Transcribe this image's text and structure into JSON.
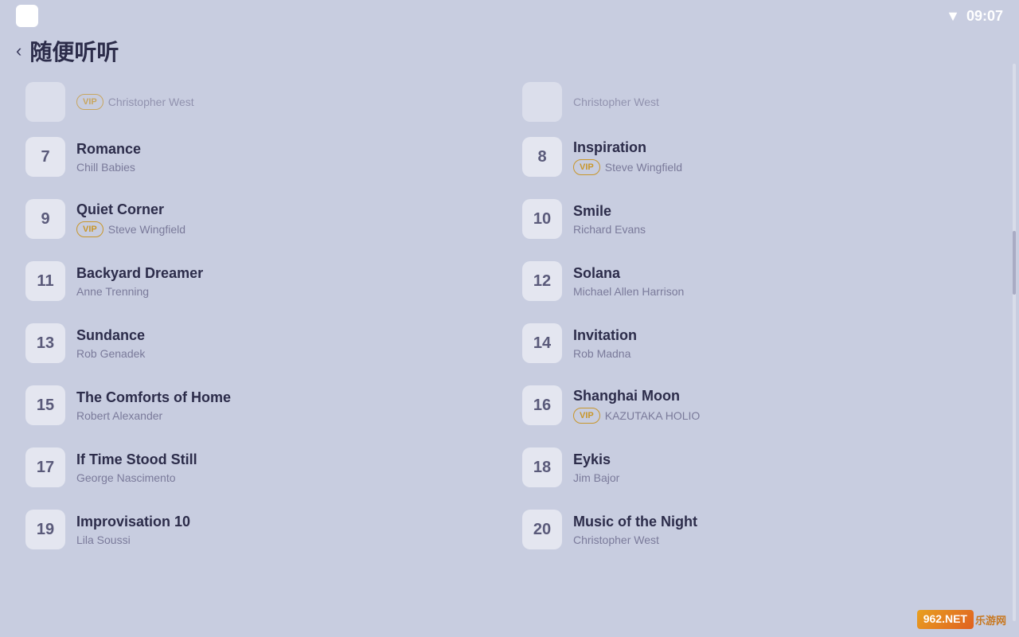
{
  "statusBar": {
    "time": "09:07",
    "wifiIcon": "▼"
  },
  "header": {
    "backLabel": "‹",
    "title": "随便听听"
  },
  "partialTopItems": [
    {
      "id": "partial-left",
      "number": "",
      "hasVip": true,
      "artist": "Christopher West"
    },
    {
      "id": "partial-right",
      "number": "",
      "hasVip": false,
      "artist": "Christopher West"
    }
  ],
  "tracks": [
    {
      "id": 7,
      "number": "7",
      "title": "Romance",
      "artist": "Chill Babies",
      "hasVip": false
    },
    {
      "id": 8,
      "number": "8",
      "title": "Inspiration",
      "artist": "Steve Wingfield",
      "hasVip": true
    },
    {
      "id": 9,
      "number": "9",
      "title": "Quiet Corner",
      "artist": "Steve Wingfield",
      "hasVip": true
    },
    {
      "id": 10,
      "number": "10",
      "title": "Smile",
      "artist": "Richard Evans",
      "hasVip": false
    },
    {
      "id": 11,
      "number": "11",
      "title": "Backyard Dreamer",
      "artist": "Anne Trenning",
      "hasVip": false
    },
    {
      "id": 12,
      "number": "12",
      "title": "Solana",
      "artist": "Michael Allen Harrison",
      "hasVip": false
    },
    {
      "id": 13,
      "number": "13",
      "title": "Sundance",
      "artist": "Rob Genadek",
      "hasVip": false
    },
    {
      "id": 14,
      "number": "14",
      "title": "Invitation",
      "artist": "Rob Madna",
      "hasVip": false
    },
    {
      "id": 15,
      "number": "15",
      "title": "The Comforts of Home",
      "artist": "Robert Alexander",
      "hasVip": false
    },
    {
      "id": 16,
      "number": "16",
      "title": "Shanghai Moon",
      "artist": "KAZUTAKA HOLIO",
      "hasVip": true
    },
    {
      "id": 17,
      "number": "17",
      "title": "If Time Stood Still",
      "artist": "George Nascimento",
      "hasVip": false
    },
    {
      "id": 18,
      "number": "18",
      "title": "Eykis",
      "artist": "Jim Bajor",
      "hasVip": false
    },
    {
      "id": 19,
      "number": "19",
      "title": "Improvisation 10",
      "artist": "Lila Soussi",
      "hasVip": false
    },
    {
      "id": 20,
      "number": "20",
      "title": "Music of the Night",
      "artist": "Christopher West",
      "hasVip": false
    }
  ],
  "vipLabel": "VIP",
  "watermark": {
    "main": "962.NET",
    "sub": "乐游网"
  }
}
